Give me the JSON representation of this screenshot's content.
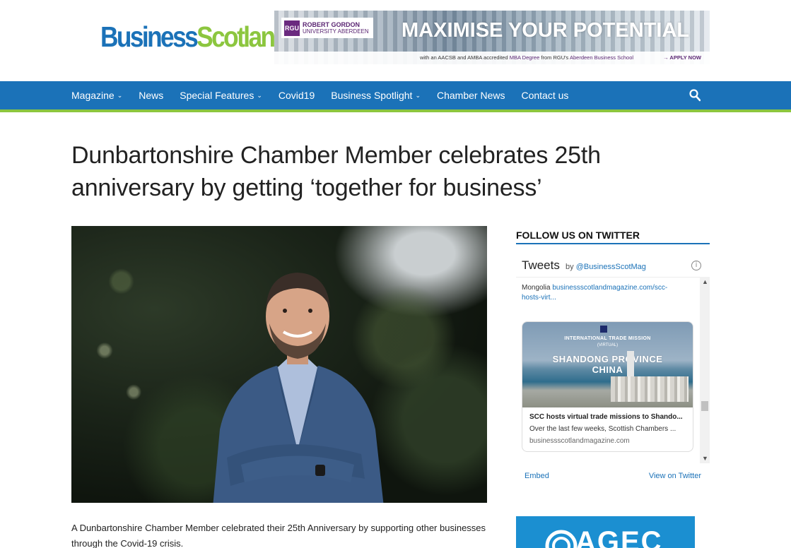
{
  "header": {
    "logo_part1": "Business",
    "logo_part2": "Scotland",
    "banner": {
      "rgu_mark": "RGU",
      "rgu_line1": "ROBERT GORDON",
      "rgu_line2": "UNIVERSITY ABERDEEN",
      "headline": "MAXIMISE YOUR POTENTIAL",
      "subline_start": "with an AACSB and AMBA accredited",
      "subline_mba": "MBA Degree",
      "subline_mid": "from RGU's",
      "subline_school": "Aberdeen Business School",
      "apply": "→ APPLY NOW"
    }
  },
  "nav": {
    "items": [
      {
        "label": "Magazine",
        "caret": "⌄"
      },
      {
        "label": "News",
        "caret": ""
      },
      {
        "label": "Special Features",
        "caret": "⌄"
      },
      {
        "label": "Covid19",
        "caret": ""
      },
      {
        "label": "Business Spotlight",
        "caret": "⌄"
      },
      {
        "label": "Chamber News",
        "caret": ""
      },
      {
        "label": "Contact us",
        "caret": ""
      }
    ]
  },
  "article": {
    "title": "Dunbartonshire Chamber Member celebrates 25th anniversary by getting ‘together for business’",
    "body": "A Dunbartonshire Chamber Member celebrated their 25th Anniversary by supporting other businesses through the Covid-19 crisis."
  },
  "sidebar": {
    "follow_title": "FOLLOW US ON TWITTER",
    "twitter": {
      "heading": "Tweets",
      "by": "by",
      "handle": "@BusinessScotMag",
      "info": "i",
      "tweet_text": "Mongolia",
      "tweet_link": "businessscotlandmagazine.com/scc-hosts-virt...",
      "card": {
        "img_label_1": "INTERNATIONAL TRADE MISSION",
        "img_label_2": "(VIRTUAL)",
        "img_label_3": "SHANDONG PROVINCE",
        "img_label_4": "CHINA",
        "title": "SCC hosts virtual trade missions to Shando...",
        "desc": "Over the last few weeks, Scottish Chambers ...",
        "domain": "businessscotlandmagazine.com"
      },
      "embed": "Embed",
      "view": "View on Twitter"
    },
    "ad2_text": "AGEC"
  },
  "colors": {
    "brand_blue": "#1b72b8",
    "brand_green": "#8cc63f"
  }
}
